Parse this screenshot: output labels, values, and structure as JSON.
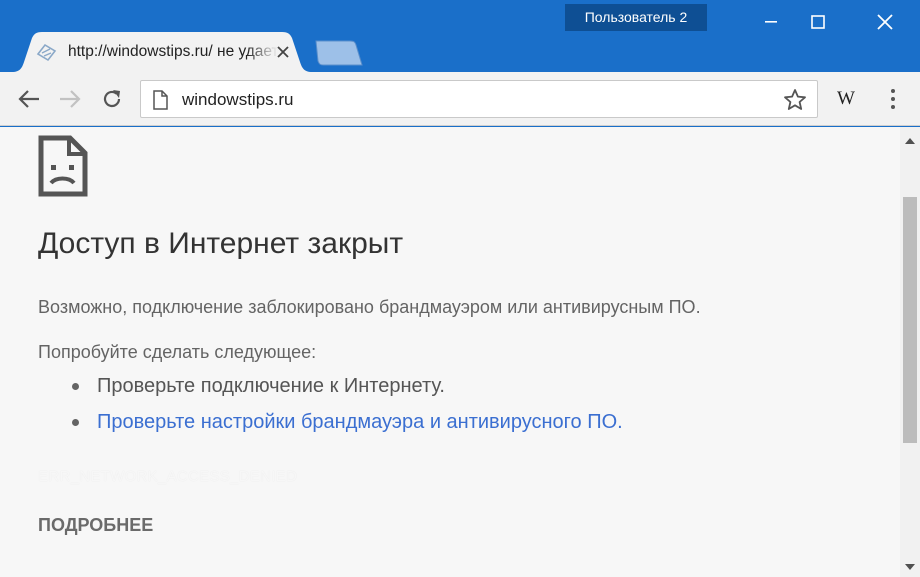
{
  "window": {
    "profile_label": "Пользователь 2",
    "controls": [
      "minimize",
      "maximize",
      "close"
    ]
  },
  "tabs": [
    {
      "title": "http://windowstips.ru/ не удается получить доступ к сайту",
      "favicon": "broken-page-favicon-icon",
      "active": true
    }
  ],
  "toolbar": {
    "back_icon": "back-arrow-icon",
    "forward_icon": "forward-arrow-icon",
    "reload_icon": "reload-icon",
    "url": "windowstips.ru",
    "bookmark_icon": "star-icon",
    "extension_label": "W",
    "menu_icon": "three-dots-menu-icon"
  },
  "error_page": {
    "icon": "sad-page-icon",
    "heading": "Доступ в Интернет закрыт",
    "description": "Возможно, подключение заблокировано брандмауэром или антивирусным ПО.",
    "try_label": "Попробуйте сделать следующее:",
    "suggestions": [
      {
        "text": "Проверьте подключение к Интернету.",
        "is_link": false
      },
      {
        "text": "Проверьте настройки брандмауэра и антивирусного ПО.",
        "is_link": true
      }
    ],
    "error_code": "ERR_NETWORK_ACCESS_DENIED",
    "details_button": "ПОДРОБНЕЕ"
  },
  "colors": {
    "title_bar": "#1a6fc9",
    "profile_badge": "#0e4f94",
    "link": "#3b6fd1",
    "page_background": "#f7f7f7"
  }
}
